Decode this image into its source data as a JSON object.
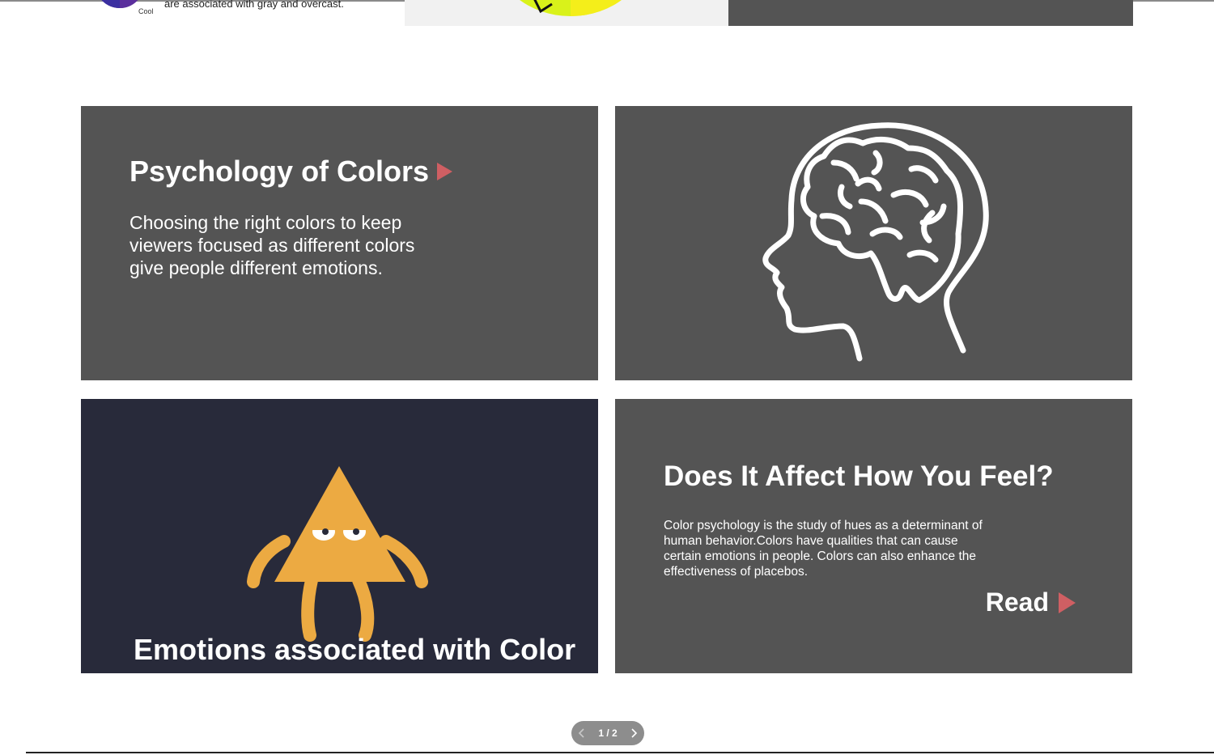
{
  "top_strip": {
    "wheel_label": "Cool",
    "caption": "are associated with gray and overcast."
  },
  "tiles": {
    "psychology": {
      "title": "Psychology of Colors",
      "description": "Choosing the right colors to keep viewers focused as different colors give people different emotions."
    },
    "brain": {
      "image_icon": "head-brain-outline-icon"
    },
    "emotions": {
      "title": "Emotions associated with Color",
      "image_icon": "triangle-character-icon"
    },
    "feel": {
      "title": "Does It Affect How You Feel?",
      "description": "Color psychology is the study of hues as a determinant of human behavior.Colors have qualities that can cause certain emotions in people. Colors can also enhance the effectiveness of placebos.",
      "read_label": "Read"
    }
  },
  "pager": {
    "label": "1 / 2",
    "current_page": 1,
    "total_pages": 2
  },
  "colors": {
    "tile_gray": "#545454",
    "tile_navy": "#282a3a",
    "accent_arrow": "#cf5f63",
    "character_orange": "#ecaa42",
    "pager_bg": "#8d8d8d"
  }
}
